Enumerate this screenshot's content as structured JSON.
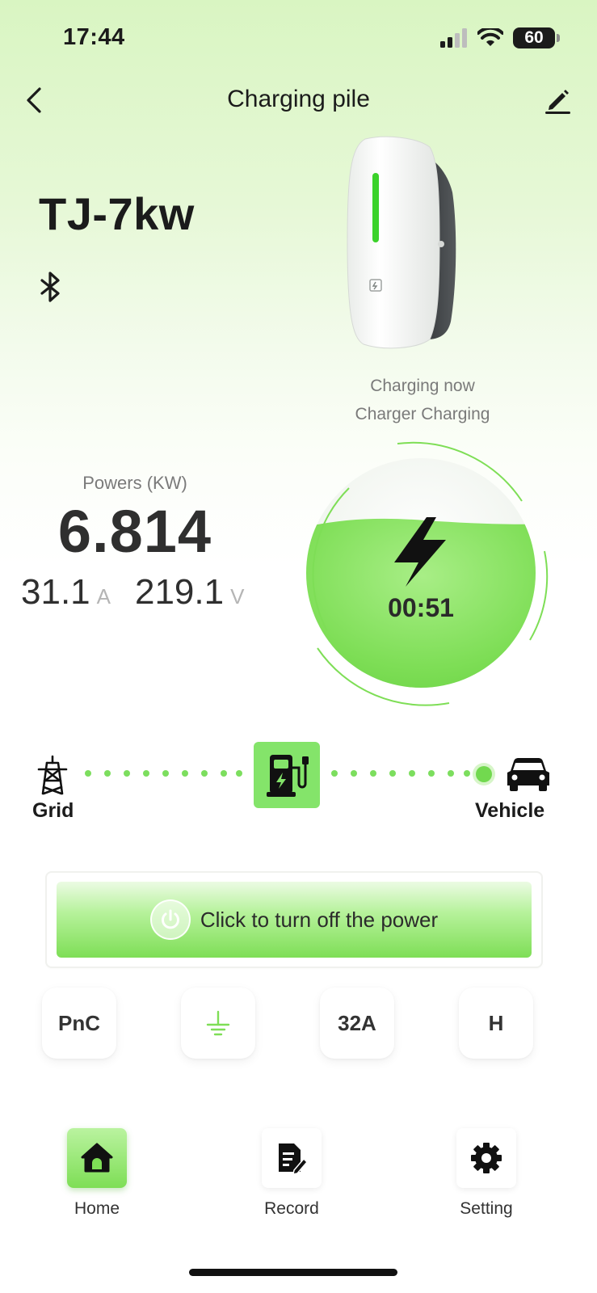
{
  "status_bar": {
    "time": "17:44",
    "battery": "60"
  },
  "header": {
    "title": "Charging pile",
    "back_icon": "chevron-left-icon",
    "edit_icon": "pencil-icon"
  },
  "device": {
    "name": "TJ-7kw",
    "connection_icon": "bluetooth-icon"
  },
  "charge_status": {
    "line1": "Charging now",
    "line2": "Charger Charging",
    "elapsed": "00:51"
  },
  "metrics": {
    "power_label": "Powers (KW)",
    "power_value": "6.814",
    "current_value": "31.1",
    "current_unit": "A",
    "voltage_value": "219.1",
    "voltage_unit": "V"
  },
  "flow": {
    "source_label": "Grid",
    "target_label": "Vehicle"
  },
  "power_button": {
    "label": "Click to turn off the power"
  },
  "chips": [
    {
      "label": "PnC"
    },
    {
      "label": "",
      "icon": "ground-icon"
    },
    {
      "label": "32A"
    },
    {
      "label": "H"
    }
  ],
  "nav": [
    {
      "label": "Home",
      "icon": "home-icon",
      "active": true
    },
    {
      "label": "Record",
      "icon": "document-edit-icon",
      "active": false
    },
    {
      "label": "Setting",
      "icon": "gear-icon",
      "active": false
    }
  ],
  "colors": {
    "accent": "#7ede56",
    "accent_light": "#d9f5c2",
    "text": "#1b1b1b",
    "muted": "#7a7a7a"
  }
}
